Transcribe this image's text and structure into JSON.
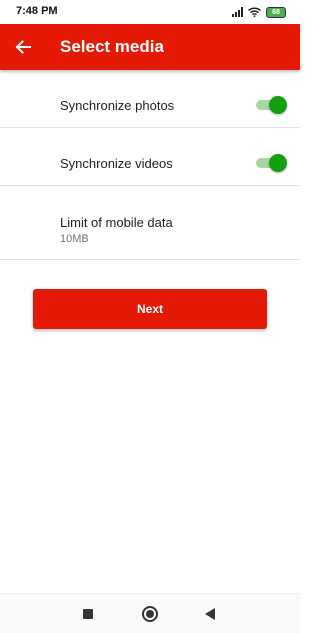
{
  "status_bar": {
    "time": "7:48 PM",
    "battery": "68"
  },
  "app_bar": {
    "title": "Select media",
    "back_icon": "arrow-left-icon"
  },
  "settings": [
    {
      "label": "Synchronize photos",
      "type": "toggle",
      "value": true
    },
    {
      "label": "Synchronize videos",
      "type": "toggle",
      "value": true
    },
    {
      "label": "Limit of mobile data",
      "type": "value",
      "value": "10MB"
    }
  ],
  "next_button": {
    "label": "Next"
  },
  "colors": {
    "brand": "#e41a06",
    "toggle_on": "#13a00e",
    "toggle_track": "#a8d5a0"
  },
  "nav_bar": {
    "icons": [
      "recents-square-icon",
      "home-circle-icon",
      "back-triangle-icon"
    ]
  }
}
